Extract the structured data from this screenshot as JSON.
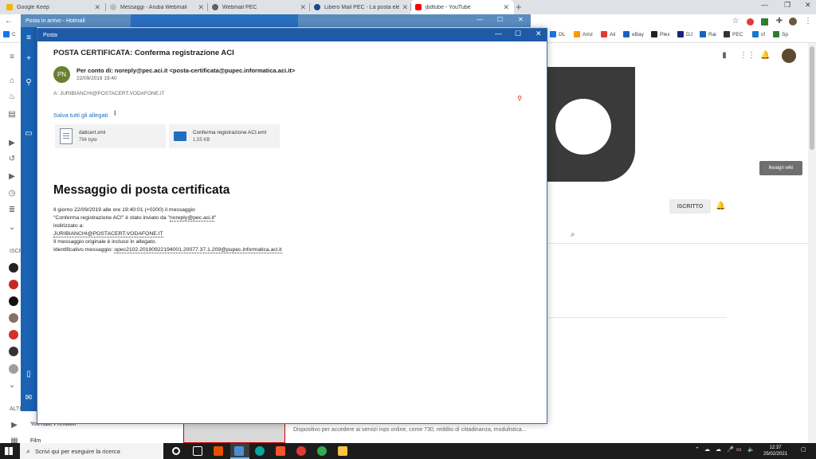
{
  "browser": {
    "tabs": [
      {
        "title": "Google Keep",
        "color": "#f4b400"
      },
      {
        "title": "Messaggi - Aruba Webmail",
        "color": "#bdbdbd"
      },
      {
        "title": "Webmail PEC",
        "color": "#5f6368"
      },
      {
        "title": "Libero Mail PEC - La posta elettr",
        "color": "#1a4a8a"
      },
      {
        "title": "jbdtube - YouTube",
        "color": "#ff0000"
      }
    ],
    "bookmarks": [
      "DL",
      "Amz",
      "Ali",
      "eBay",
      "Plex",
      "DJ",
      "Rai",
      "PEC",
      "cf",
      "Sp"
    ],
    "bookmark_prefix": "C"
  },
  "youtube": {
    "ikea_button": "Ikeaign wiki",
    "subscribed_label": "ISCRITTO",
    "sidebar_iscr": "ISCR",
    "sidebar_altro": "ALTRO",
    "sidebar_premium": "YouTube Premium",
    "sidebar_film": "Film",
    "bottom_text": "Dispositivo per accedere ai servizi inps online, come 730, reddito di cittadinanza, modulistica..."
  },
  "mail_app": {
    "title": "Posta in arrivo - Hotmail"
  },
  "message_window": {
    "title": "Posta",
    "subject": "POSTA CERTIFICATA: Conferma registrazione ACI",
    "avatar_initials": "PN",
    "sender": "Per conto di: noreply@pec.aci.it <posta-certificata@pupec.informatica.aci.it>",
    "date": "22/09/2019 19:40",
    "recipient": "A: JURIBIANCHI@POSTACERT.VODAFONE.IT",
    "save_all": "Salva tutti gli allegati",
    "attachments": [
      {
        "name": "daticert.xml",
        "size": "794 byte"
      },
      {
        "name": "Conferma registrazione ACI.eml",
        "size": "1,55 KB"
      }
    ],
    "heading": "Messaggio di posta certificata",
    "body": {
      "line1": "Il giorno 22/09/2019 alle ore 19:40:01 (+0200) il messaggio",
      "line2a": "\"Conferma registrazione ACI\" è stato inviato da \"",
      "line2_link": "noreply@pec.aci.it",
      "line2b": "\"",
      "line3": "indirizzato a:",
      "line4": "JURIBIANCHI@POSTACERT.VODAFONE.IT",
      "line5": "Il messaggio originale è incluso in allegato.",
      "line6a": "Identificativo messaggio: ",
      "line6_id": "opec2102.20190922194001.20077.37.1.209@pupec.informatica.aci.it"
    }
  },
  "taskbar": {
    "search_placeholder": "Scrivi qui per eseguire la ricerca",
    "time": "12:37",
    "date": "25/02/2021"
  }
}
